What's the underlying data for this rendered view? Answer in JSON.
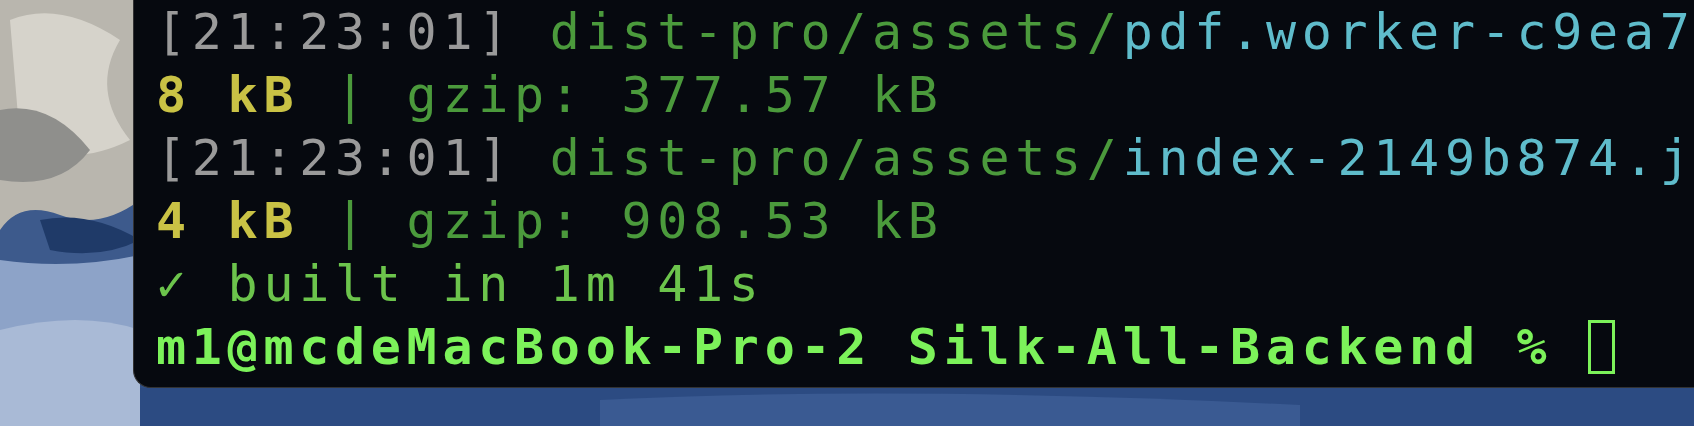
{
  "terminal": {
    "lines": [
      {
        "segments": [
          {
            "kind": "timestamp",
            "text": "[21:23:01]"
          },
          {
            "kind": "path",
            "text": "dist-pro/assets/"
          },
          {
            "kind": "file",
            "text": "pdf.worker-c9ea7"
          }
        ]
      },
      {
        "segments": [
          {
            "kind": "size",
            "text": "8 kB"
          },
          {
            "kind": "info",
            "text": "| gzip: 377.57 kB"
          }
        ]
      },
      {
        "segments": [
          {
            "kind": "timestamp",
            "text": "[21:23:01]"
          },
          {
            "kind": "path",
            "text": "dist-pro/assets/"
          },
          {
            "kind": "file",
            "text": "index-2149b874.j"
          }
        ]
      },
      {
        "segments": [
          {
            "kind": "size",
            "text": "4 kB"
          },
          {
            "kind": "info",
            "text": "| gzip: 908.53 kB"
          }
        ]
      },
      {
        "segments": [
          {
            "kind": "success",
            "text": "✓ built in 1m 41s"
          }
        ]
      }
    ],
    "prompt": {
      "text": "m1@mcdeMacBook-Pro-2 Silk-All-Backend %"
    }
  }
}
